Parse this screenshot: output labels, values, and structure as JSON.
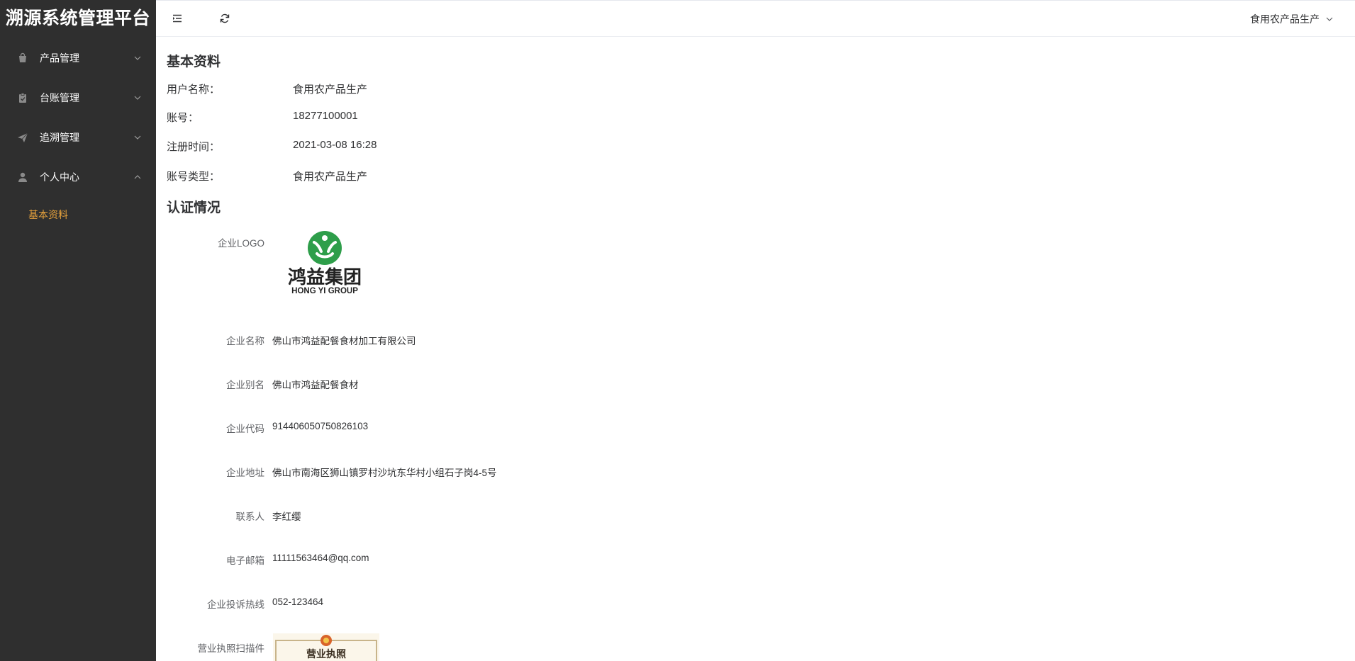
{
  "sidebar": {
    "brand": "溯源系统管理平台",
    "menu": [
      {
        "label": "产品管理",
        "icon": "bag-icon"
      },
      {
        "label": "台账管理",
        "icon": "clipboard-icon"
      },
      {
        "label": "追溯管理",
        "icon": "paper-plane-icon"
      },
      {
        "label": "个人中心",
        "icon": "user-icon"
      }
    ],
    "submenu_active": "基本资料"
  },
  "header": {
    "user_label": "食用农产品生产"
  },
  "basic": {
    "title": "基本资料",
    "rows": [
      {
        "label": "用户名称：",
        "value": "食用农产品生产"
      },
      {
        "label": "账号：",
        "value": "18277100001"
      },
      {
        "label": "注册时间：",
        "value": "2021-03-08 16:28"
      },
      {
        "label": "账号类型：",
        "value": "食用农产品生产"
      }
    ]
  },
  "cert": {
    "title": "认证情况",
    "logo_label": "企业LOGO",
    "logo_text_cn": "鸿益集团",
    "logo_text_en": "HONG YI GROUP",
    "rows": [
      {
        "label": "企业名称",
        "value": "佛山市鸿益配餐食材加工有限公司"
      },
      {
        "label": "企业别名",
        "value": "佛山市鸿益配餐食材"
      },
      {
        "label": "企业代码",
        "value": "914406050750826103"
      },
      {
        "label": "企业地址",
        "value": "佛山市南海区狮山镇罗村沙坑东华村小组石子岗4-5号"
      },
      {
        "label": "联系人",
        "value": "李红缨"
      },
      {
        "label": "电子邮箱",
        "value": "11111563464@qq.com"
      },
      {
        "label": "企业投诉热线",
        "value": "052-123464"
      }
    ],
    "license_label": "营业执照扫描件",
    "license_text": "营业执照"
  },
  "colors": {
    "sidebar_bg": "#2f2f2f",
    "active_submenu": "#e6a23c",
    "logo_green": "#2e9e4a"
  }
}
